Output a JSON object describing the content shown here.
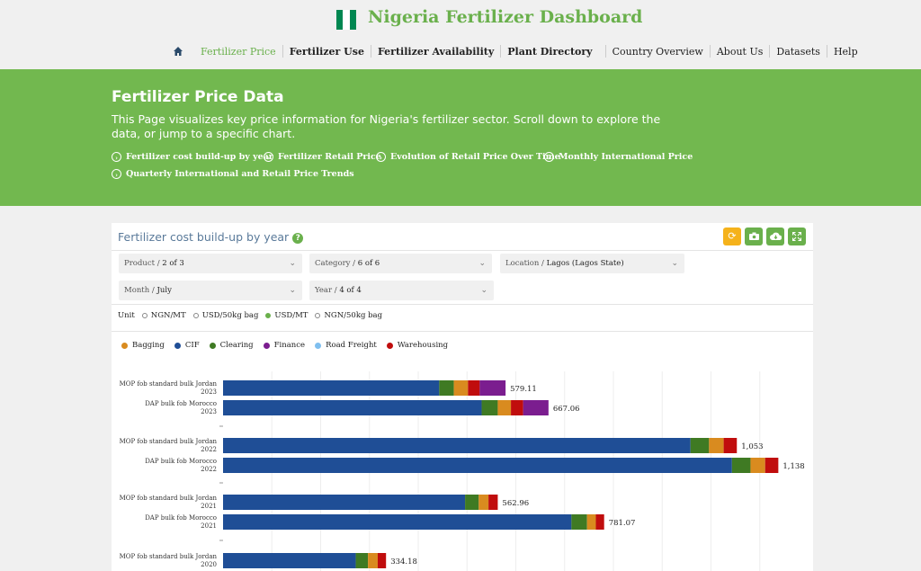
{
  "header": {
    "title": "Nigeria Fertilizer Dashboard",
    "flag_colors": [
      "#008751",
      "#ffffff",
      "#008751"
    ],
    "nav": [
      {
        "label": "Fertilizer Price",
        "active": true
      },
      {
        "label": "Fertilizer Use"
      },
      {
        "label": "Fertilizer Availability"
      },
      {
        "label": "Plant Directory"
      },
      {
        "label": "Country Overview"
      },
      {
        "label": "About Us"
      },
      {
        "label": "Datasets"
      },
      {
        "label": "Help"
      }
    ]
  },
  "hero": {
    "title": "Fertilizer Price Data",
    "description": "This Page visualizes key price information for Nigeria's fertilizer sector. Scroll down to explore the data, or jump to a specific chart.",
    "links": [
      "Fertilizer cost build-up by year",
      "Fertilizer Retail Price",
      "Evolution of Retail Price Over Time",
      "Monthly International Price",
      "Quarterly International and Retail Price Trends"
    ]
  },
  "card": {
    "title": "Fertilizer cost build-up by year",
    "help_icon": "?",
    "toolbar": [
      {
        "icon": "refresh-icon",
        "color": "#f5b21b"
      },
      {
        "icon": "camera-icon",
        "color": "#6ab04c"
      },
      {
        "icon": "cloud-download-icon",
        "color": "#6ab04c"
      },
      {
        "icon": "expand-icon",
        "color": "#6ab04c"
      }
    ],
    "filters": {
      "product": {
        "label": "Product /",
        "value": "2 of 3"
      },
      "category": {
        "label": "Category /",
        "value": "6 of 6"
      },
      "location": {
        "label": "Location /",
        "value": "Lagos (Lagos State)"
      },
      "month": {
        "label": "Month /",
        "value": "July"
      },
      "year": {
        "label": "Year /",
        "value": "4 of 4"
      }
    },
    "unit": {
      "label": "Unit",
      "options": [
        "NGN/MT",
        "USD/50kg bag",
        "USD/MT",
        "NGN/50kg bag"
      ],
      "selected": "USD/MT"
    }
  },
  "chart_data": {
    "type": "bar",
    "orientation": "horizontal",
    "stacked": true,
    "legend": [
      {
        "name": "Bagging",
        "color": "#d98b1f"
      },
      {
        "name": "CIF",
        "color": "#1f4e96"
      },
      {
        "name": "Clearing",
        "color": "#3f7a23"
      },
      {
        "name": "Finance",
        "color": "#7b1d8f"
      },
      {
        "name": "Road Freight",
        "color": "#7fbfef"
      },
      {
        "name": "Warehousing",
        "color": "#c00d0d"
      }
    ],
    "xlim": [
      0,
      1200
    ],
    "grid": true,
    "bars": [
      {
        "product": "MOP fob standard bulk Jordan",
        "year": "2023",
        "total_label": "579.11",
        "segments": {
          "CIF": 443,
          "Clearing": 30,
          "Bagging": 29,
          "Warehousing": 24,
          "Road Freight": 0,
          "Finance": 53
        }
      },
      {
        "product": "DAP bulk fob Morocco",
        "year": "2023",
        "total_label": "667.06",
        "segments": {
          "CIF": 530,
          "Clearing": 33,
          "Bagging": 27,
          "Warehousing": 25,
          "Road Freight": 0,
          "Finance": 52
        }
      },
      {
        "product": "MOP fob standard bulk Jordan",
        "year": "2022",
        "total_label": "1,053",
        "segments": {
          "CIF": 958,
          "Clearing": 38,
          "Bagging": 30,
          "Warehousing": 27,
          "Road Freight": 0,
          "Finance": 0
        }
      },
      {
        "product": "DAP bulk fob Morocco",
        "year": "2022",
        "total_label": "1,138",
        "segments": {
          "CIF": 1043,
          "Clearing": 38,
          "Bagging": 30,
          "Warehousing": 27,
          "Road Freight": 0,
          "Finance": 0
        }
      },
      {
        "product": "MOP fob standard bulk Jordan",
        "year": "2021",
        "total_label": "562.96",
        "segments": {
          "CIF": 496,
          "Clearing": 28,
          "Bagging": 20,
          "Warehousing": 19,
          "Road Freight": 0,
          "Finance": 0
        }
      },
      {
        "product": "DAP bulk fob Morocco",
        "year": "2021",
        "total_label": "781.07",
        "segments": {
          "CIF": 714,
          "Clearing": 32,
          "Bagging": 18,
          "Warehousing": 17,
          "Road Freight": 0,
          "Finance": 0
        }
      },
      {
        "product": "MOP fob standard bulk Jordan",
        "year": "2020",
        "total_label": "334.18",
        "segments": {
          "CIF": 272,
          "Clearing": 25,
          "Bagging": 20,
          "Warehousing": 17,
          "Road Freight": 0,
          "Finance": 0
        }
      }
    ]
  }
}
